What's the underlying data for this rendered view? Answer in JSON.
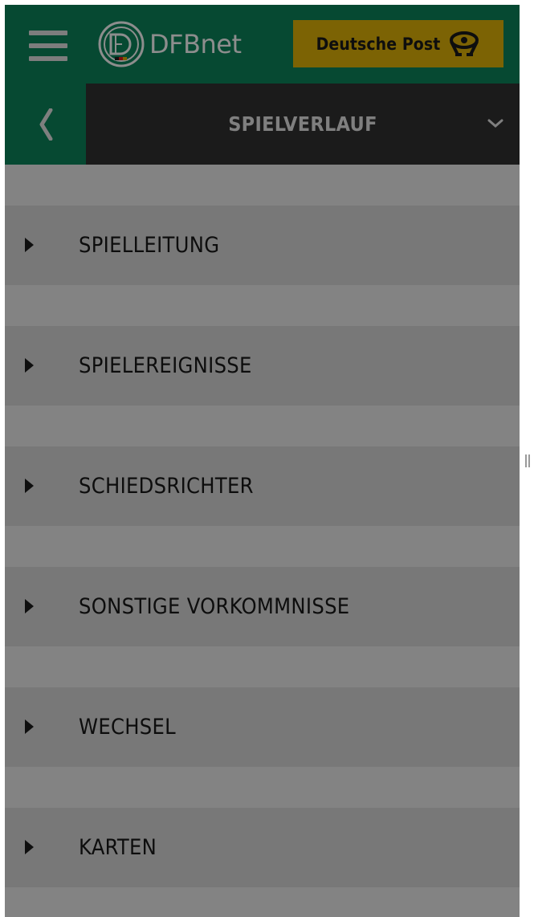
{
  "header": {
    "menu_icon": "hamburger-menu-icon",
    "brand": "DFBnet",
    "sponsor": "Deutsche Post",
    "sponsor_icon": "post-horn-icon",
    "colors": {
      "header_bg": "#064932",
      "sponsor_bg": "#7c6304"
    }
  },
  "subheader": {
    "back_icon": "chevron-left-icon",
    "title": "SPIELVERLAUF",
    "dropdown_icon": "chevron-down-icon"
  },
  "sections": [
    {
      "label": "SPIELLEITUNG"
    },
    {
      "label": "SPIELEREIGNISSE"
    },
    {
      "label": "SCHIEDSRICHTER"
    },
    {
      "label": "SONSTIGE VORKOMMNISSE"
    },
    {
      "label": "WECHSEL"
    },
    {
      "label": "KARTEN"
    }
  ],
  "row_arrow_icon": "triangle-right-icon"
}
